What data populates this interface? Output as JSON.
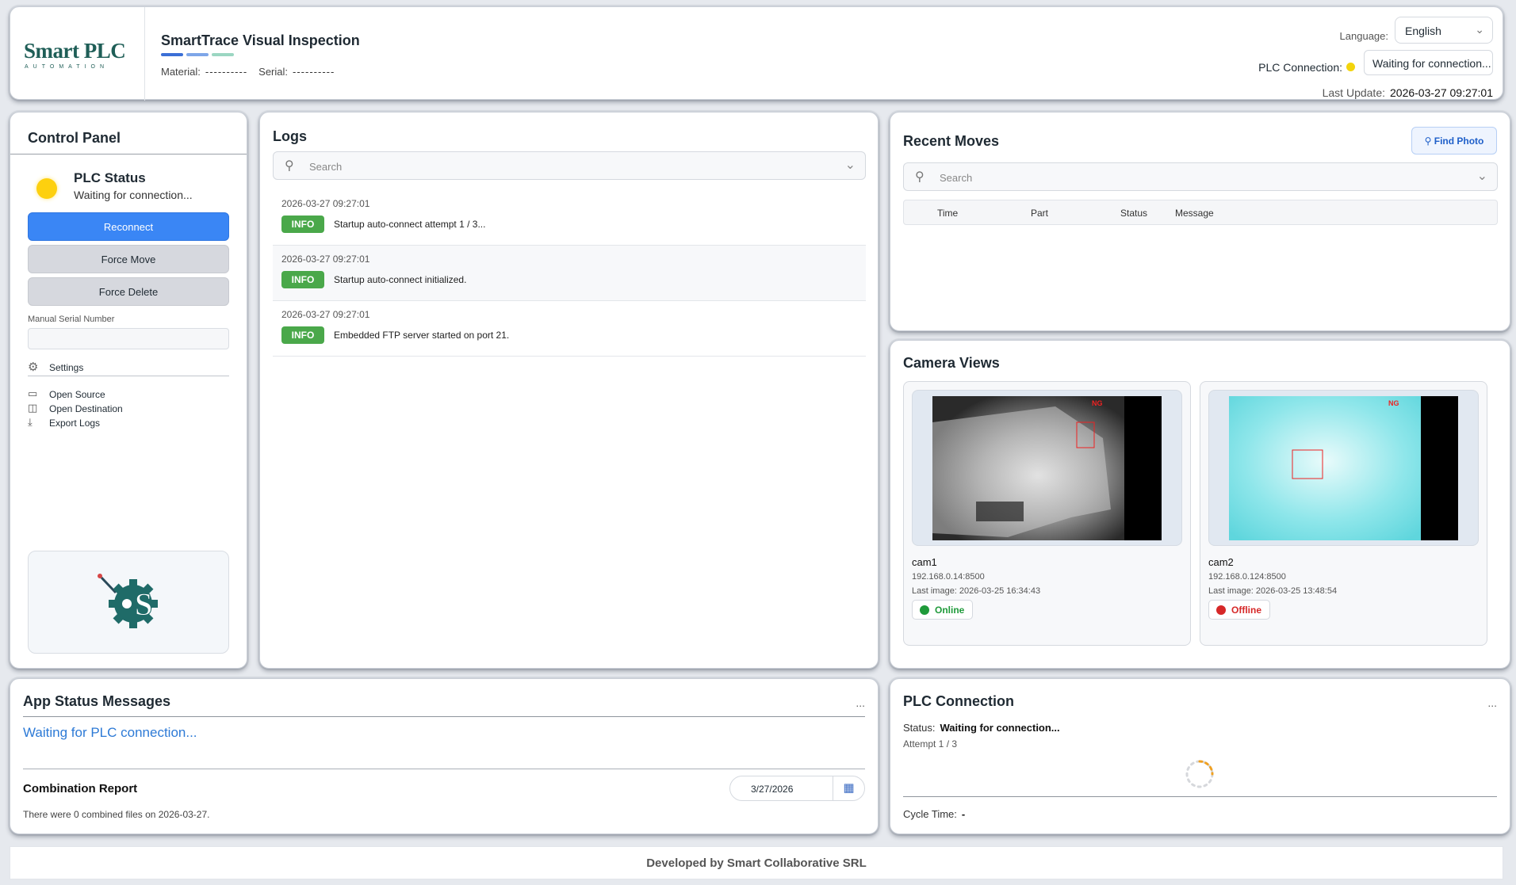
{
  "header": {
    "logo_text": "Smart PLC",
    "logo_sub": "AUTOMATION",
    "app_title": "SmartTrace Visual Inspection",
    "title_bar_colors": [
      "#3b6fd6",
      "#7ea6e8",
      "#9bd6c2"
    ],
    "material_label": "Material:",
    "material_value": "----------",
    "serial_label": "Serial:",
    "serial_value": "----------",
    "language_label": "Language:",
    "language_value": "English",
    "plc_connection_label": "PLC Connection:",
    "plc_connection_value": "Waiting for connection...",
    "last_update_label": "Last Update:",
    "last_update_value": "2026-03-27 09:27:01"
  },
  "control_panel": {
    "title": "Control Panel",
    "plc_status_title": "PLC Status",
    "plc_status_sub": "Waiting for connection...",
    "reconnect_label": "Reconnect",
    "force_move_label": "Force Move",
    "force_delete_label": "Force Delete",
    "manual_serial_label": "Manual Serial Number",
    "manual_serial_value": "",
    "settings_label": "Settings",
    "links": [
      "Open Source",
      "Open Destination",
      "Export Logs"
    ]
  },
  "logs": {
    "title": "Logs",
    "search_placeholder": "Search",
    "entries": [
      {
        "time": "2026-03-27 09:27:01",
        "level": "INFO",
        "message": "Startup auto-connect attempt 1 / 3..."
      },
      {
        "time": "2026-03-27 09:27:01",
        "level": "INFO",
        "message": "Startup auto-connect initialized."
      },
      {
        "time": "2026-03-27 09:27:01",
        "level": "INFO",
        "message": "Embedded FTP server started on port 21."
      }
    ]
  },
  "recent_moves": {
    "title": "Recent Moves",
    "find_photo_label": "Find Photo",
    "search_placeholder": "Search",
    "columns": [
      "Time",
      "Part",
      "Status",
      "Message"
    ]
  },
  "cameras": {
    "title": "Camera Views",
    "items": [
      {
        "name": "cam1",
        "ip": "192.168.0.14:8500",
        "last_image": "Last image: 2026-03-25 16:34:43",
        "status": "Online",
        "status_color": "#1f9a3a"
      },
      {
        "name": "cam2",
        "ip": "192.168.0.124:8500",
        "last_image": "Last image: 2026-03-25 13:48:54",
        "status": "Offline",
        "status_color": "#d62828"
      }
    ]
  },
  "app_status": {
    "title": "App Status Messages",
    "ellipsis": "...",
    "message": "Waiting for PLC connection...",
    "combination_title": "Combination Report",
    "combination_date": "3/27/2026",
    "combination_text": "There were 0 combined files on 2026-03-27."
  },
  "plc_connection": {
    "title": "PLC Connection",
    "ellipsis": "...",
    "status_label": "Status:",
    "status_value": "Waiting for connection...",
    "attempt": "Attempt 1 / 3",
    "cycle_label": "Cycle Time:",
    "cycle_value": "-"
  },
  "footer": {
    "text": "Developed by Smart Collaborative SRL"
  },
  "colors": {
    "accent": "#3a86f5",
    "status_yellow": "#fdd00f",
    "info_green": "#4aa84a",
    "brand_teal": "#1f5e57"
  },
  "icons": {
    "search": "search-icon",
    "chevron": "chevron-down-icon",
    "settings": "gear-icon",
    "calendar": "calendar-icon",
    "find_photo": "search-icon"
  }
}
